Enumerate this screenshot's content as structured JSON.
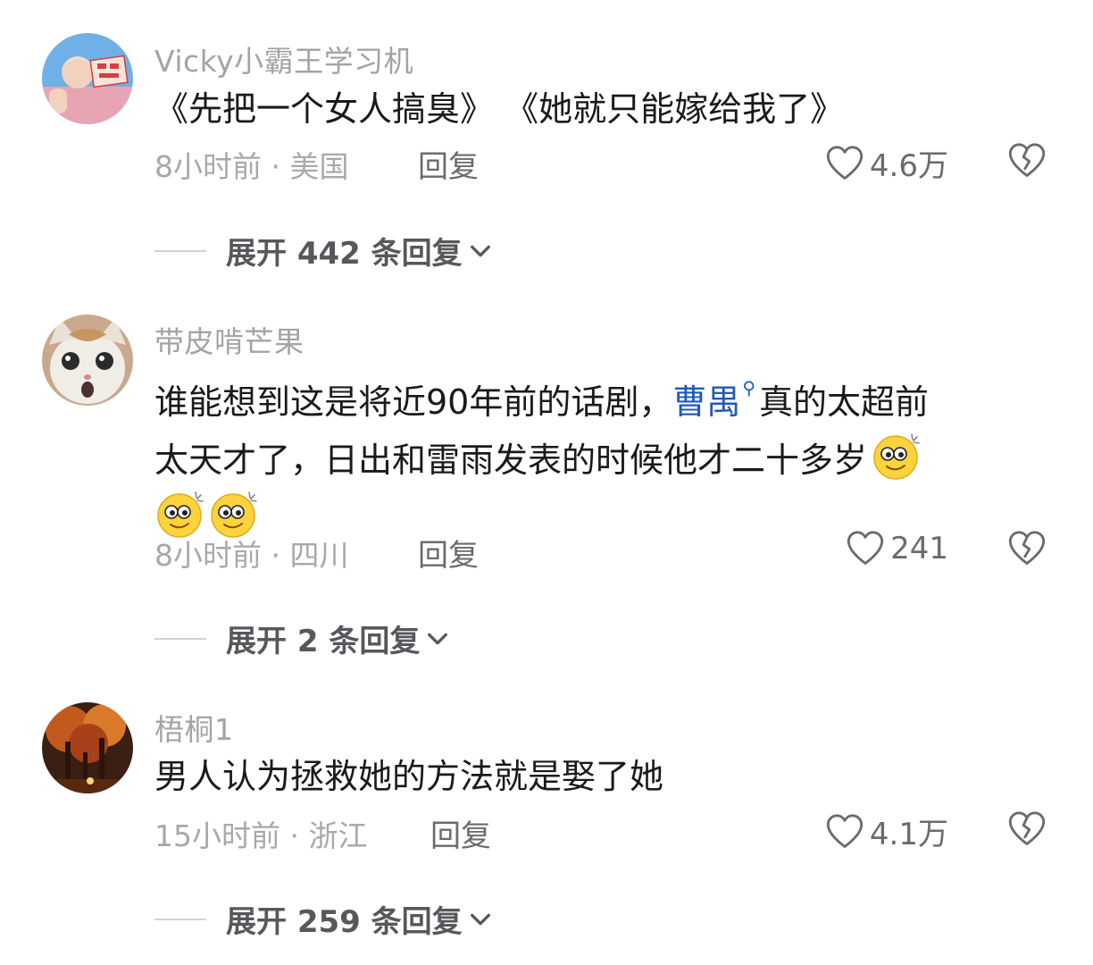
{
  "comments": [
    {
      "username": "Vicky小霸王学习机",
      "avatar_icon": "avatar-grandma-with-sign-icon",
      "text_lines": [
        "《先把一个女人搞臭》 《她就只能嫁给我了》"
      ],
      "time_location": "8小时前 · 美国",
      "reply_label": "回复",
      "likes": "4.6万",
      "expand_label": "展开 442 条回复"
    },
    {
      "username": "带皮啃芒果",
      "avatar_icon": "avatar-cat-icon",
      "text_pre": "谁能想到这是将近90年前的话剧，",
      "mention": "曹禺",
      "text_post": "真的太超前",
      "text_line2": "太天才了，日出和雷雨发表的时候他才二十多岁",
      "time_location": "8小时前 · 四川",
      "reply_label": "回复",
      "likes": "241",
      "expand_label": "展开 2 条回复"
    },
    {
      "username": "梧桐1",
      "avatar_icon": "avatar-autumn-trees-icon",
      "text_lines": [
        "男人认为拯救她的方法就是娶了她"
      ],
      "time_location": "15小时前 · 浙江",
      "reply_label": "回复",
      "likes": "4.1万",
      "expand_label": "展开 259 条回复"
    }
  ],
  "colors": {
    "username": "#a3a3a8",
    "text": "#1a1a1a",
    "mention": "#1e5bb8",
    "meta": "#a8a8ad",
    "action": "#6a6a70"
  }
}
